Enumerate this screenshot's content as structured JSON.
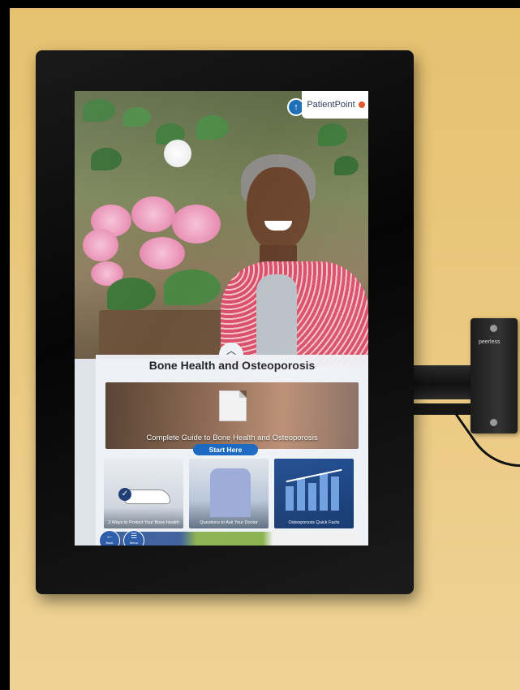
{
  "branding": {
    "name": "PatientPoint",
    "mount_brand": "peerless"
  },
  "panel": {
    "title": "Bone Health and Osteoporosis",
    "guide_title": "Complete Guide to Bone Health and Osteoporosis",
    "start_label": "Start Here"
  },
  "tiles": [
    {
      "caption": "3 Ways to Protect Your Bone Health"
    },
    {
      "caption": "Questions to Ask Your Doctor"
    },
    {
      "caption": "Osteoporosis Quick Facts"
    }
  ],
  "nav": {
    "back_label": "Back",
    "menu_label": "Menu"
  },
  "icons": {
    "logo": "patientpoint-logo-icon",
    "expand": "chevron-up-icon",
    "document": "document-icon",
    "check": "check-icon",
    "back": "back-arrow-icon",
    "menu": "menu-icon"
  },
  "colors": {
    "accent": "#1464c0",
    "brand_dot": "#e0552c"
  }
}
